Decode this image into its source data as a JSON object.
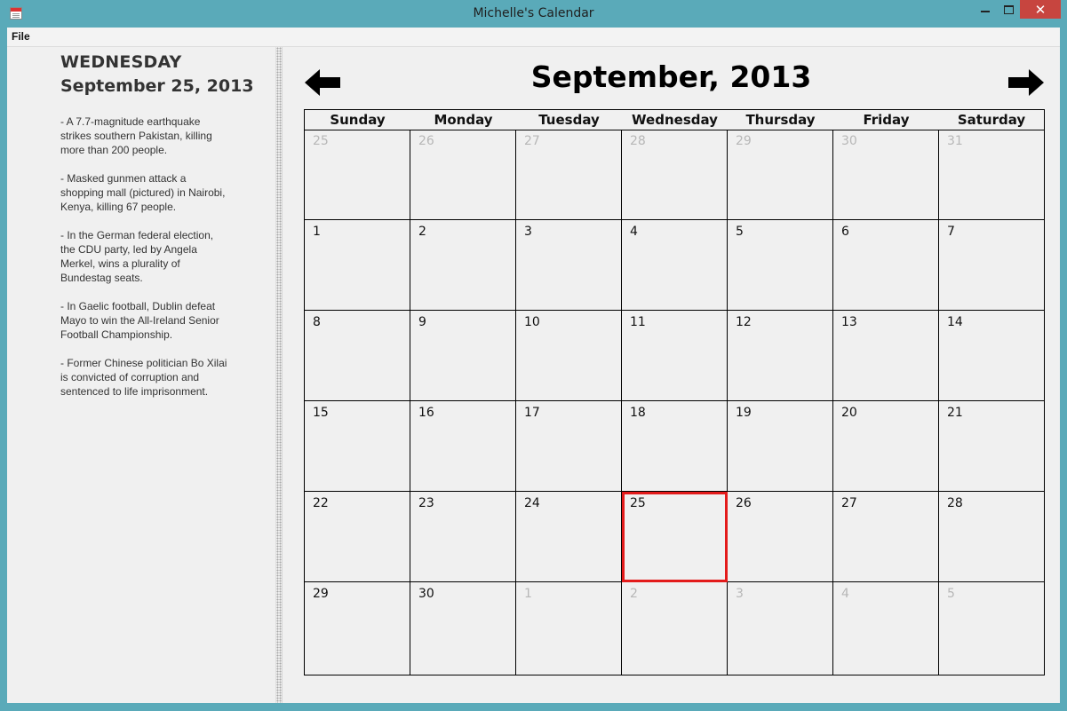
{
  "window": {
    "title": "Michelle's Calendar",
    "close_glyph": "✕"
  },
  "menu": {
    "file": "File"
  },
  "sidebar": {
    "weekday": "WEDNESDAY",
    "date": "September 25, 2013",
    "news": [
      "- A 7.7-magnitude earthquake strikes southern Pakistan, killing more than 200 people.",
      "- Masked gunmen attack a shopping mall (pictured) in Nairobi, Kenya, killing 67 people.",
      "- In the German federal election, the CDU party, led by Angela Merkel, wins a plurality of Bundestag seats.",
      "- In Gaelic football, Dublin defeat Mayo to win the All-Ireland Senior Football Championship.",
      "- Former Chinese politician Bo Xilai is convicted of corruption and sentenced to life imprisonment."
    ]
  },
  "calendar": {
    "month_title": "September, 2013",
    "prev_icon": "arrow-left-icon",
    "next_icon": "arrow-right-icon",
    "weekdays": [
      "Sunday",
      "Monday",
      "Tuesday",
      "Wednesday",
      "Thursday",
      "Friday",
      "Saturday"
    ],
    "selected_day": 25,
    "selection_color": "#e31b1b",
    "out_of_month_color": "#b7b7b7",
    "weeks": [
      [
        {
          "d": "25",
          "o": true
        },
        {
          "d": "26",
          "o": true
        },
        {
          "d": "27",
          "o": true
        },
        {
          "d": "28",
          "o": true
        },
        {
          "d": "29",
          "o": true
        },
        {
          "d": "30",
          "o": true
        },
        {
          "d": "31",
          "o": true
        }
      ],
      [
        {
          "d": "1"
        },
        {
          "d": "2"
        },
        {
          "d": "3"
        },
        {
          "d": "4"
        },
        {
          "d": "5"
        },
        {
          "d": "6"
        },
        {
          "d": "7"
        }
      ],
      [
        {
          "d": "8"
        },
        {
          "d": "9"
        },
        {
          "d": "10"
        },
        {
          "d": "11"
        },
        {
          "d": "12"
        },
        {
          "d": "13"
        },
        {
          "d": "14"
        }
      ],
      [
        {
          "d": "15"
        },
        {
          "d": "16"
        },
        {
          "d": "17"
        },
        {
          "d": "18"
        },
        {
          "d": "19"
        },
        {
          "d": "20"
        },
        {
          "d": "21"
        }
      ],
      [
        {
          "d": "22"
        },
        {
          "d": "23"
        },
        {
          "d": "24"
        },
        {
          "d": "25",
          "sel": true
        },
        {
          "d": "26"
        },
        {
          "d": "27"
        },
        {
          "d": "28"
        }
      ],
      [
        {
          "d": "29"
        },
        {
          "d": "30"
        },
        {
          "d": "1",
          "o": true
        },
        {
          "d": "2",
          "o": true
        },
        {
          "d": "3",
          "o": true
        },
        {
          "d": "4",
          "o": true
        },
        {
          "d": "5",
          "o": true
        }
      ]
    ]
  }
}
